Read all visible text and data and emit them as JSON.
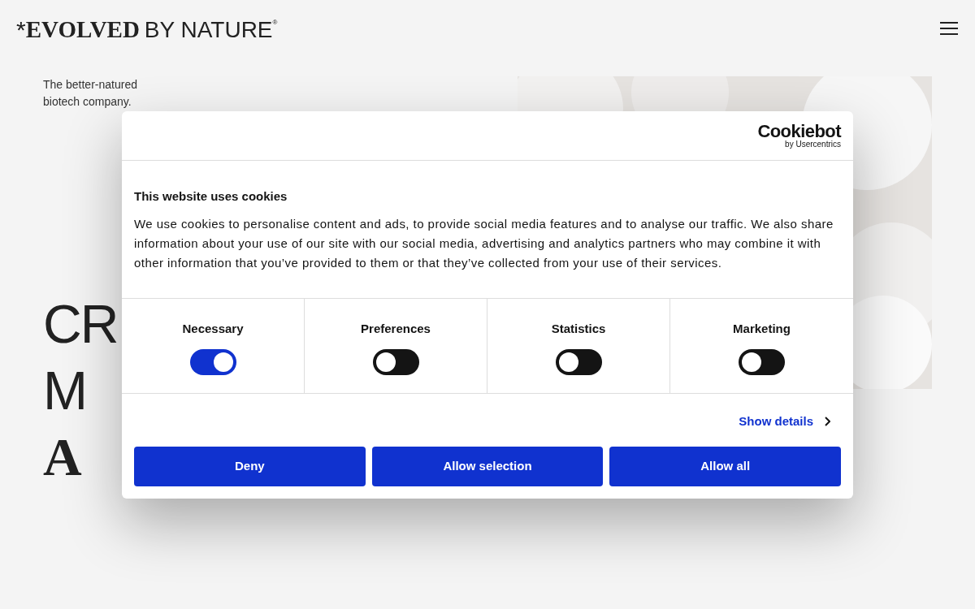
{
  "header": {
    "logo": {
      "mark": "*",
      "strong": "EVOLVED",
      "light": "BY NATURE",
      "registered": "®"
    }
  },
  "tagline": [
    "The better-natured",
    "biotech company."
  ],
  "hero": {
    "lines": [
      {
        "text": "CR",
        "kind": "sans"
      },
      {
        "text": "M",
        "kind": "sans"
      },
      {
        "text": "A",
        "kind": "serif"
      }
    ]
  },
  "hero_image": {
    "kind": "picture"
  },
  "cookie_dialog": {
    "brand": {
      "name": "Cookiebot",
      "by": "by Usercentrics"
    },
    "title": "This website uses cookies",
    "body": "We use cookies to personalise content and ads, to provide social media features and to analyse our traffic. We also share information about your use of our site with our social media, advertising and analytics partners who may combine it with other information that you’ve provided to them or that they’ve collected from your use of their services.",
    "categories": [
      {
        "label": "Necessary",
        "on": true
      },
      {
        "label": "Preferences",
        "on": false
      },
      {
        "label": "Statistics",
        "on": false
      },
      {
        "label": "Marketing",
        "on": false
      }
    ],
    "details_link": "Show details",
    "buttons": [
      "Deny",
      "Allow selection",
      "Allow all"
    ]
  }
}
